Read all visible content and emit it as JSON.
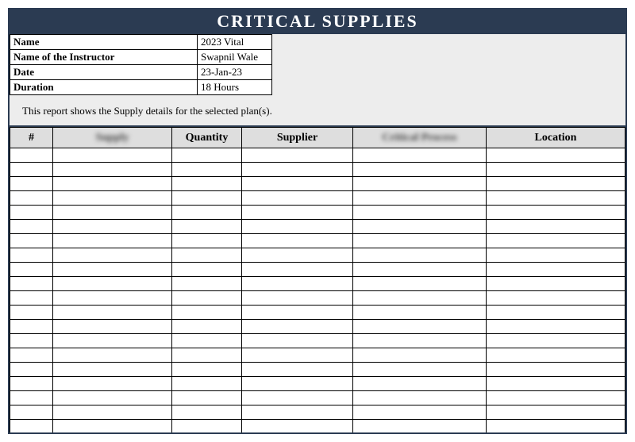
{
  "title": "CRITICAL SUPPLIES",
  "meta": {
    "name_label": "Name",
    "name_value": "2023 Vital",
    "instructor_label": "Name of the Instructor",
    "instructor_value": "Swapnil Wale",
    "date_label": "Date",
    "date_value": "23-Jan-23",
    "duration_label": "Duration",
    "duration_value": "18 Hours"
  },
  "description": "This report shows the Supply details for the selected plan(s).",
  "columns": {
    "num": "#",
    "supply": "Supply",
    "quantity": "Quantity",
    "supplier": "Supplier",
    "critical": "Critical Process",
    "location": "Location"
  },
  "rows": [
    {
      "num": "",
      "supply": "",
      "quantity": "",
      "supplier": "",
      "critical": "",
      "location": ""
    },
    {
      "num": "",
      "supply": "",
      "quantity": "",
      "supplier": "",
      "critical": "",
      "location": ""
    },
    {
      "num": "",
      "supply": "",
      "quantity": "",
      "supplier": "",
      "critical": "",
      "location": ""
    },
    {
      "num": "",
      "supply": "",
      "quantity": "",
      "supplier": "",
      "critical": "",
      "location": ""
    },
    {
      "num": "",
      "supply": "",
      "quantity": "",
      "supplier": "",
      "critical": "",
      "location": ""
    },
    {
      "num": "",
      "supply": "",
      "quantity": "",
      "supplier": "",
      "critical": "",
      "location": ""
    },
    {
      "num": "",
      "supply": "",
      "quantity": "",
      "supplier": "",
      "critical": "",
      "location": ""
    },
    {
      "num": "",
      "supply": "",
      "quantity": "",
      "supplier": "",
      "critical": "",
      "location": ""
    },
    {
      "num": "",
      "supply": "",
      "quantity": "",
      "supplier": "",
      "critical": "",
      "location": ""
    },
    {
      "num": "",
      "supply": "",
      "quantity": "",
      "supplier": "",
      "critical": "",
      "location": ""
    },
    {
      "num": "",
      "supply": "",
      "quantity": "",
      "supplier": "",
      "critical": "",
      "location": ""
    },
    {
      "num": "",
      "supply": "",
      "quantity": "",
      "supplier": "",
      "critical": "",
      "location": ""
    },
    {
      "num": "",
      "supply": "",
      "quantity": "",
      "supplier": "",
      "critical": "",
      "location": ""
    },
    {
      "num": "",
      "supply": "",
      "quantity": "",
      "supplier": "",
      "critical": "",
      "location": ""
    },
    {
      "num": "",
      "supply": "",
      "quantity": "",
      "supplier": "",
      "critical": "",
      "location": ""
    },
    {
      "num": "",
      "supply": "",
      "quantity": "",
      "supplier": "",
      "critical": "",
      "location": ""
    },
    {
      "num": "",
      "supply": "",
      "quantity": "",
      "supplier": "",
      "critical": "",
      "location": ""
    },
    {
      "num": "",
      "supply": "",
      "quantity": "",
      "supplier": "",
      "critical": "",
      "location": ""
    },
    {
      "num": "",
      "supply": "",
      "quantity": "",
      "supplier": "",
      "critical": "",
      "location": ""
    },
    {
      "num": "",
      "supply": "",
      "quantity": "",
      "supplier": "",
      "critical": "",
      "location": ""
    }
  ]
}
